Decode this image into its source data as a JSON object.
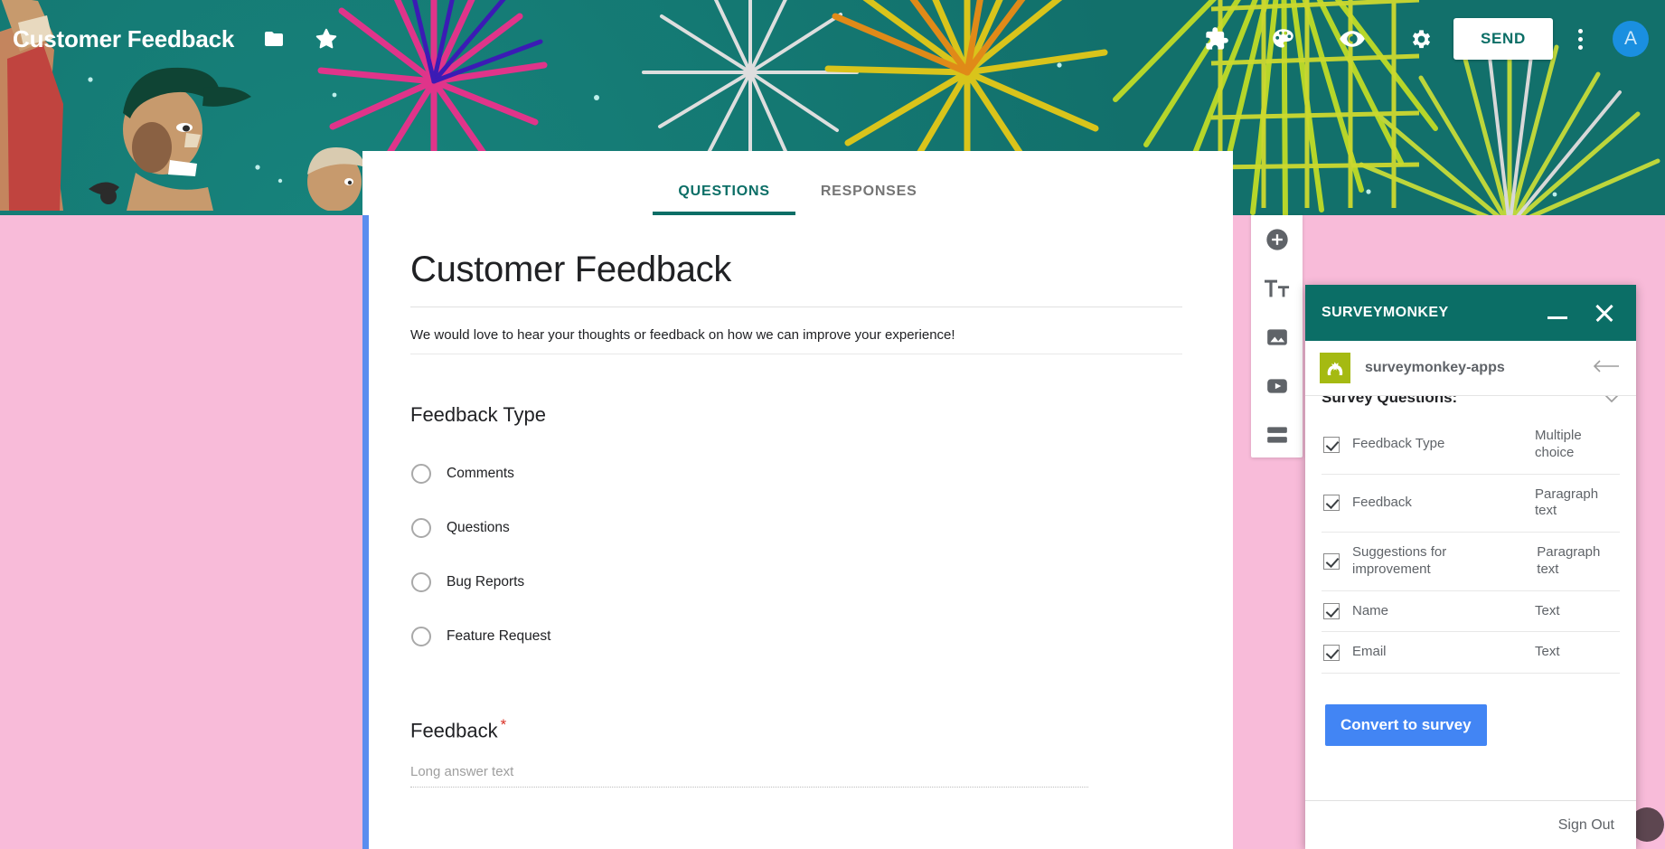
{
  "topbar": {
    "form_title": "Customer Feedback",
    "folder_icon": "folder-icon",
    "star_icon": "star-icon",
    "addons_icon": "puzzle-addons-icon",
    "theme_icon": "palette-theme-icon",
    "preview_icon": "eye-preview-icon",
    "settings_icon": "gear-settings-icon",
    "send_label": "SEND",
    "more_icon": "kebab-more-icon",
    "avatar_initial": "A",
    "accent_color": "#0b6e66",
    "avatar_color": "#1a8fe0"
  },
  "tabs": [
    {
      "label": "QUESTIONS",
      "active": true
    },
    {
      "label": "RESPONSES",
      "active": false
    }
  ],
  "form": {
    "heading": "Customer Feedback",
    "description": "We would love to hear your thoughts or feedback on how we can improve your experience!",
    "questions": [
      {
        "title": "Feedback Type",
        "required": false,
        "type": "radio",
        "options": [
          "Comments",
          "Questions",
          "Bug Reports",
          "Feature Request"
        ]
      },
      {
        "title": "Feedback",
        "required": true,
        "required_mark": "*",
        "type": "paragraph",
        "placeholder": "Long answer text"
      }
    ]
  },
  "side_tools": [
    {
      "icon": "add-circle-icon",
      "name": "add-question-button"
    },
    {
      "icon": "title-text-icon",
      "name": "add-title-button"
    },
    {
      "icon": "image-icon",
      "name": "add-image-button"
    },
    {
      "icon": "video-icon",
      "name": "add-video-button"
    },
    {
      "icon": "section-icon",
      "name": "add-section-button"
    }
  ],
  "surveymonkey": {
    "panel_title": "SURVEYMONKEY",
    "minimize_icon": "minimize-icon",
    "close_icon": "close-icon",
    "account_name": "surveymonkey-apps",
    "back_icon": "arrow-left-icon",
    "logo_color": "#a5ba12",
    "header_color": "#0b6e66",
    "section_label": "Survey Questions:",
    "collapse_icon": "chevron-up-icon",
    "questions": [
      {
        "name": "Feedback Type",
        "type": "Multiple choice",
        "checked": true
      },
      {
        "name": "Feedback",
        "type": "Paragraph text",
        "checked": true
      },
      {
        "name": "Suggestions for improvement",
        "type": "Paragraph text",
        "checked": true
      },
      {
        "name": "Name",
        "type": "Text",
        "checked": true
      },
      {
        "name": "Email",
        "type": "Text",
        "checked": true
      }
    ],
    "convert_label": "Convert to survey",
    "convert_color": "#4285f4",
    "signout_label": "Sign Out"
  },
  "theme": {
    "page_background": "#f8bbd9",
    "banner_color": "#13736e"
  }
}
